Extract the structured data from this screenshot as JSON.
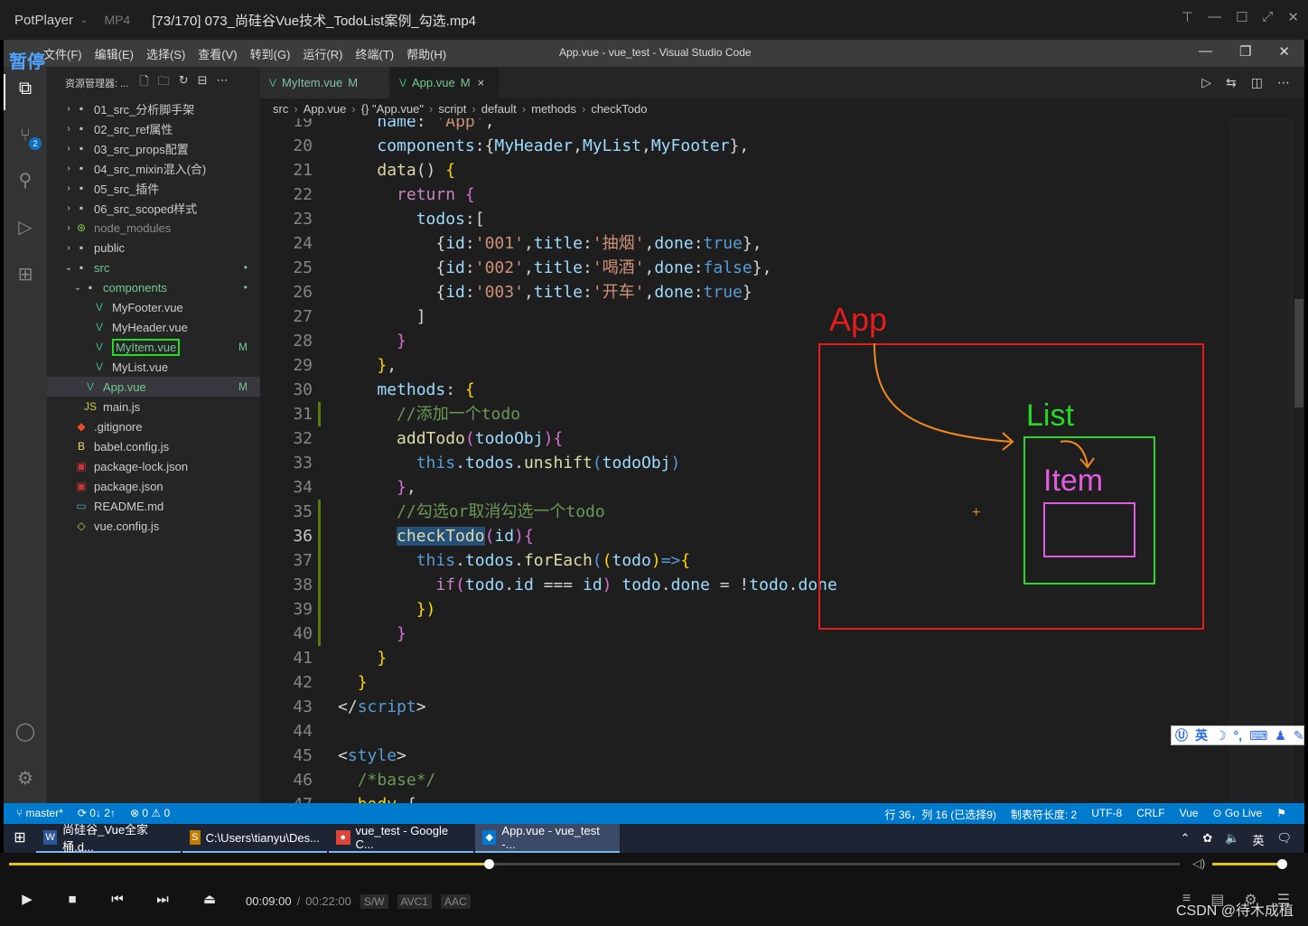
{
  "player": {
    "app_name": "PotPlayer",
    "format": "MP4",
    "file_title": "[73/170] 073_尚硅谷Vue技术_TodoList案例_勾选.mp4",
    "pause_label": "暂停",
    "time_current": "00:09:00",
    "time_sep": "/",
    "time_total": "00:22:00",
    "codec_sw": "S/W",
    "codec_video": "AVC1",
    "codec_audio": "AAC",
    "progress_fraction": 0.41,
    "volume_fraction": 0.95,
    "watermark": "CSDN @待木成植"
  },
  "vscode": {
    "window_title": "App.vue - vue_test - Visual Studio Code",
    "menu": [
      "文件(F)",
      "编辑(E)",
      "选择(S)",
      "查看(V)",
      "转到(G)",
      "运行(R)",
      "终端(T)",
      "帮助(H)"
    ],
    "explorer_title": "资源管理器: ...",
    "scm_badge": "2",
    "tree": [
      {
        "label": "01_src_分析脚手架",
        "type": "folder",
        "depth": 0,
        "arrow": "›",
        "color": "#cccccc"
      },
      {
        "label": "02_src_ref属性",
        "type": "folder",
        "depth": 0,
        "arrow": "›",
        "color": "#cccccc"
      },
      {
        "label": "03_src_props配置",
        "type": "folder",
        "depth": 0,
        "arrow": "›",
        "color": "#cccccc"
      },
      {
        "label": "04_src_mixin混入(合)",
        "type": "folder",
        "depth": 0,
        "arrow": "›",
        "color": "#cccccc"
      },
      {
        "label": "05_src_插件",
        "type": "folder",
        "depth": 0,
        "arrow": "›",
        "color": "#cccccc"
      },
      {
        "label": "06_src_scoped样式",
        "type": "folder",
        "depth": 0,
        "arrow": "›",
        "color": "#cccccc"
      },
      {
        "label": "node_modules",
        "type": "folder-node",
        "depth": 0,
        "arrow": "›",
        "color": "#8c8c8c"
      },
      {
        "label": "public",
        "type": "folder",
        "depth": 0,
        "arrow": "›",
        "color": "#cccccc"
      },
      {
        "label": "src",
        "type": "folder",
        "depth": 0,
        "arrow": "⌄",
        "color": "#73c991",
        "git": "•"
      },
      {
        "label": "components",
        "type": "folder",
        "depth": 1,
        "arrow": "⌄",
        "color": "#73c991",
        "git": "•"
      },
      {
        "label": "MyFooter.vue",
        "type": "vue",
        "depth": 2,
        "arrow": "",
        "color": "#cccccc"
      },
      {
        "label": "MyHeader.vue",
        "type": "vue",
        "depth": 2,
        "arrow": "",
        "color": "#cccccc"
      },
      {
        "label": "MyItem.vue",
        "type": "vue",
        "depth": 2,
        "arrow": "",
        "color": "#73c991",
        "git": "M",
        "boxed": true
      },
      {
        "label": "MyList.vue",
        "type": "vue",
        "depth": 2,
        "arrow": "",
        "color": "#cccccc"
      },
      {
        "label": "App.vue",
        "type": "vue",
        "depth": 1,
        "arrow": "",
        "color": "#73c991",
        "git": "M",
        "selected": true
      },
      {
        "label": "main.js",
        "type": "js",
        "depth": 1,
        "arrow": "",
        "color": "#cccccc"
      },
      {
        "label": ".gitignore",
        "type": "git",
        "depth": 0,
        "arrow": "",
        "color": "#cccccc"
      },
      {
        "label": "babel.config.js",
        "type": "babel",
        "depth": 0,
        "arrow": "",
        "color": "#cccccc"
      },
      {
        "label": "package-lock.json",
        "type": "npm",
        "depth": 0,
        "arrow": "",
        "color": "#cccccc"
      },
      {
        "label": "package.json",
        "type": "npm",
        "depth": 0,
        "arrow": "",
        "color": "#cccccc"
      },
      {
        "label": "README.md",
        "type": "md",
        "depth": 0,
        "arrow": "",
        "color": "#cccccc"
      },
      {
        "label": "vue.config.js",
        "type": "js-outline",
        "depth": 0,
        "arrow": "",
        "color": "#cccccc"
      }
    ],
    "tabs": [
      {
        "label": "MyItem.vue",
        "status": "M",
        "active": false
      },
      {
        "label": "App.vue",
        "status": "M",
        "active": true,
        "close": "×"
      }
    ],
    "breadcrumb": [
      "src",
      "App.vue",
      "{} \"App.vue\"",
      "script",
      "default",
      "methods",
      "checkTodo"
    ],
    "status": {
      "branch": "master*",
      "sync": "0↓ 2↑",
      "problems": "⊗ 0 ⚠ 0",
      "position": "行 36，列 16 (已选择9)",
      "tabsize": "制表符长度: 2",
      "encoding": "UTF-8",
      "eol": "CRLF",
      "lang": "Vue",
      "golive": "Go Live"
    },
    "code_lines": [
      {
        "n": "19",
        "tokens": [
          [
            "    ",
            "d"
          ],
          [
            "name",
            "p"
          ],
          [
            ": ",
            "d"
          ],
          [
            "'App'",
            "s"
          ],
          [
            ",",
            "d"
          ]
        ]
      },
      {
        "n": "20",
        "tokens": [
          [
            "    ",
            "d"
          ],
          [
            "components",
            "p"
          ],
          [
            ":{",
            "d"
          ],
          [
            "MyHeader",
            "p"
          ],
          [
            ",",
            "d"
          ],
          [
            "MyList",
            "p"
          ],
          [
            ",",
            "d"
          ],
          [
            "MyFooter",
            "p"
          ],
          [
            "},",
            "d"
          ]
        ]
      },
      {
        "n": "21",
        "tokens": [
          [
            "    ",
            "d"
          ],
          [
            "data",
            "f"
          ],
          [
            "() ",
            "d"
          ],
          [
            "{",
            "y"
          ]
        ]
      },
      {
        "n": "22",
        "tokens": [
          [
            "      ",
            "d"
          ],
          [
            "return",
            "kc"
          ],
          [
            " ",
            "d"
          ],
          [
            "{",
            "b"
          ]
        ]
      },
      {
        "n": "23",
        "tokens": [
          [
            "        ",
            "d"
          ],
          [
            "todos",
            "p"
          ],
          [
            ":[",
            "d"
          ]
        ]
      },
      {
        "n": "24",
        "tokens": [
          [
            "          ",
            "d"
          ],
          [
            "{",
            "d"
          ],
          [
            "id",
            "p"
          ],
          [
            ":",
            "d"
          ],
          [
            "'001'",
            "s"
          ],
          [
            ",",
            "d"
          ],
          [
            "title",
            "p"
          ],
          [
            ":",
            "d"
          ],
          [
            "'抽烟'",
            "s"
          ],
          [
            ",",
            "d"
          ],
          [
            "done",
            "p"
          ],
          [
            ":",
            "d"
          ],
          [
            "true",
            "k"
          ],
          [
            "},",
            "d"
          ]
        ]
      },
      {
        "n": "25",
        "tokens": [
          [
            "          ",
            "d"
          ],
          [
            "{",
            "d"
          ],
          [
            "id",
            "p"
          ],
          [
            ":",
            "d"
          ],
          [
            "'002'",
            "s"
          ],
          [
            ",",
            "d"
          ],
          [
            "title",
            "p"
          ],
          [
            ":",
            "d"
          ],
          [
            "'喝酒'",
            "s"
          ],
          [
            ",",
            "d"
          ],
          [
            "done",
            "p"
          ],
          [
            ":",
            "d"
          ],
          [
            "false",
            "k"
          ],
          [
            "},",
            "d"
          ]
        ]
      },
      {
        "n": "26",
        "tokens": [
          [
            "          ",
            "d"
          ],
          [
            "{",
            "d"
          ],
          [
            "id",
            "p"
          ],
          [
            ":",
            "d"
          ],
          [
            "'003'",
            "s"
          ],
          [
            ",",
            "d"
          ],
          [
            "title",
            "p"
          ],
          [
            ":",
            "d"
          ],
          [
            "'开车'",
            "s"
          ],
          [
            ",",
            "d"
          ],
          [
            "done",
            "p"
          ],
          [
            ":",
            "d"
          ],
          [
            "true",
            "k"
          ],
          [
            "}",
            "d"
          ]
        ]
      },
      {
        "n": "27",
        "tokens": [
          [
            "        ",
            "d"
          ],
          [
            "]",
            "d"
          ]
        ]
      },
      {
        "n": "28",
        "tokens": [
          [
            "      ",
            "d"
          ],
          [
            "}",
            "b"
          ]
        ]
      },
      {
        "n": "29",
        "tokens": [
          [
            "    ",
            "d"
          ],
          [
            "}",
            "y"
          ],
          [
            ",",
            "d"
          ]
        ]
      },
      {
        "n": "30",
        "tokens": [
          [
            "    ",
            "d"
          ],
          [
            "methods",
            "p"
          ],
          [
            ": ",
            "d"
          ],
          [
            "{",
            "y"
          ]
        ]
      },
      {
        "n": "31",
        "tokens": [
          [
            "      ",
            "d"
          ],
          [
            "//添加一个todo",
            "c"
          ]
        ]
      },
      {
        "n": "32",
        "tokens": [
          [
            "      ",
            "d"
          ],
          [
            "addTodo",
            "f"
          ],
          [
            "(",
            "b"
          ],
          [
            "todoObj",
            "p"
          ],
          [
            ")",
            "b"
          ],
          [
            "{",
            "b"
          ]
        ]
      },
      {
        "n": "33",
        "tokens": [
          [
            "        ",
            "d"
          ],
          [
            "this",
            "k"
          ],
          [
            ".",
            "d"
          ],
          [
            "todos",
            "p"
          ],
          [
            ".",
            "d"
          ],
          [
            "unshift",
            "f"
          ],
          [
            "(",
            "k"
          ],
          [
            "todoObj",
            "p"
          ],
          [
            ")",
            "k"
          ]
        ]
      },
      {
        "n": "34",
        "tokens": [
          [
            "      ",
            "d"
          ],
          [
            "}",
            "b"
          ],
          [
            ",",
            "d"
          ]
        ]
      },
      {
        "n": "35",
        "tokens": [
          [
            "      ",
            "d"
          ],
          [
            "//勾选or取消勾选一个todo",
            "c"
          ]
        ]
      },
      {
        "n": "36",
        "tokens": [
          [
            "      ",
            "d"
          ],
          [
            "checkTodo",
            "f hl"
          ],
          [
            "(",
            "b"
          ],
          [
            "id",
            "p"
          ],
          [
            ")",
            "b"
          ],
          [
            "{",
            "b"
          ]
        ]
      },
      {
        "n": "37",
        "tokens": [
          [
            "        ",
            "d"
          ],
          [
            "this",
            "k"
          ],
          [
            ".",
            "d"
          ],
          [
            "todos",
            "p"
          ],
          [
            ".",
            "d"
          ],
          [
            "forEach",
            "f"
          ],
          [
            "(",
            "k"
          ],
          [
            "(",
            "y"
          ],
          [
            "todo",
            "p"
          ],
          [
            ")",
            "y"
          ],
          [
            "=>",
            "k"
          ],
          [
            "{",
            "y"
          ]
        ]
      },
      {
        "n": "38",
        "tokens": [
          [
            "          ",
            "d"
          ],
          [
            "if",
            "kc"
          ],
          [
            "(",
            "b"
          ],
          [
            "todo",
            "p"
          ],
          [
            ".",
            "d"
          ],
          [
            "id",
            "p"
          ],
          [
            " === ",
            "d"
          ],
          [
            "id",
            "p"
          ],
          [
            ") ",
            "b"
          ],
          [
            "todo",
            "p"
          ],
          [
            ".",
            "d"
          ],
          [
            "done",
            "p"
          ],
          [
            " = !",
            "d"
          ],
          [
            "todo",
            "p"
          ],
          [
            ".",
            "d"
          ],
          [
            "done",
            "p"
          ]
        ]
      },
      {
        "n": "39",
        "tokens": [
          [
            "        ",
            "d"
          ],
          [
            "})",
            "y"
          ]
        ]
      },
      {
        "n": "40",
        "tokens": [
          [
            "      ",
            "d"
          ],
          [
            "}",
            "b"
          ]
        ]
      },
      {
        "n": "41",
        "tokens": [
          [
            "    ",
            "d"
          ],
          [
            "}",
            "y"
          ]
        ]
      },
      {
        "n": "42",
        "tokens": [
          [
            "  ",
            "d"
          ],
          [
            "}",
            "y"
          ]
        ]
      },
      {
        "n": "43",
        "tokens": [
          [
            "</",
            "o"
          ],
          [
            "script",
            "t"
          ],
          [
            ">",
            "o"
          ]
        ]
      },
      {
        "n": "44",
        "tokens": [
          [
            "",
            "d"
          ]
        ]
      },
      {
        "n": "45",
        "tokens": [
          [
            "<",
            "o"
          ],
          [
            "style",
            "t"
          ],
          [
            ">",
            "o"
          ]
        ]
      },
      {
        "n": "46",
        "tokens": [
          [
            "  ",
            "d"
          ],
          [
            "/*base*/",
            "c"
          ]
        ]
      },
      {
        "n": "47",
        "tokens": [
          [
            "  ",
            "d"
          ],
          [
            "body",
            "y"
          ],
          [
            " {",
            "d"
          ]
        ]
      }
    ]
  },
  "annotation": {
    "app_label": "App",
    "list_label": "List",
    "item_label": "Item",
    "app_color": "#e51c1c",
    "list_color": "#27d827",
    "item_color": "#e05ce0",
    "arrow_color": "#f08a1e",
    "cursor": "+"
  },
  "ime": {
    "lang": "英"
  },
  "taskbar": {
    "tasks": [
      {
        "label": "尚硅谷_Vue全家桶.d...",
        "icon": "W",
        "bg": "#2b579a"
      },
      {
        "label": "C:\\Users\\tianyu\\Des...",
        "icon": "S",
        "bg": "#c07c00"
      },
      {
        "label": "vue_test - Google C...",
        "icon": "●",
        "bg": "#db4437"
      },
      {
        "label": "App.vue - vue_test -...",
        "icon": "◆",
        "bg": "#0078d4",
        "active": true
      }
    ],
    "tray_lang": "英"
  }
}
